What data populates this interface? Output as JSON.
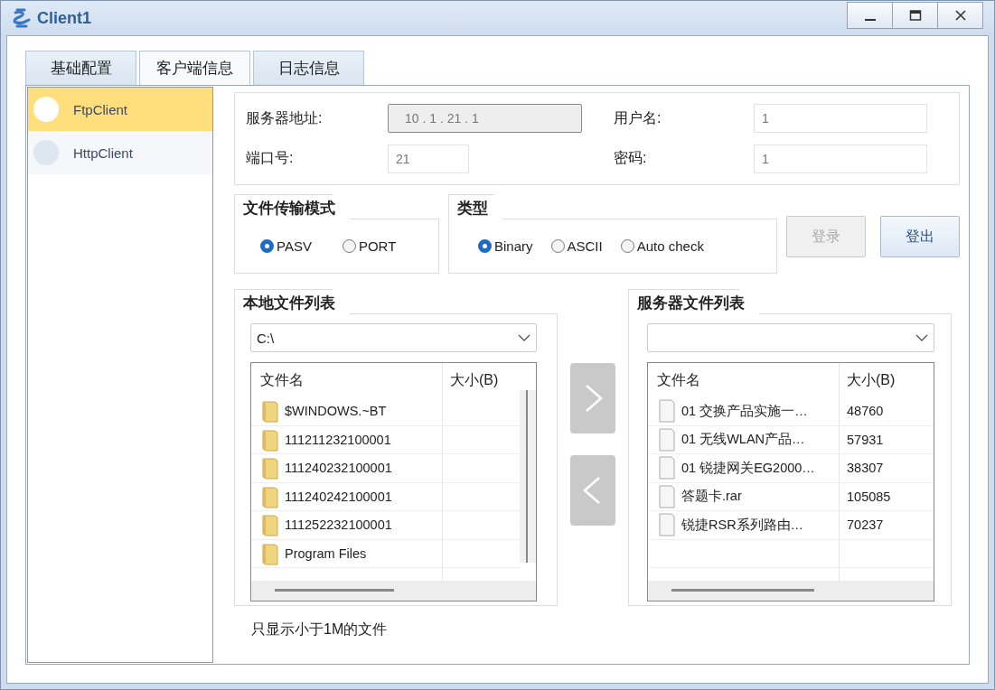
{
  "window": {
    "title": "Client1"
  },
  "tabs": [
    {
      "label": "基础配置",
      "selected": false
    },
    {
      "label": "客户端信息",
      "selected": true
    },
    {
      "label": "日志信息",
      "selected": false
    }
  ],
  "sidebar": {
    "items": [
      {
        "label": "FtpClient",
        "selected": true
      },
      {
        "label": "HttpClient",
        "selected": false
      }
    ]
  },
  "server": {
    "address_label": "服务器地址:",
    "address": "10 . 1 . 21 . 1",
    "port_label": "端口号:",
    "port": "21",
    "username_label": "用户名:",
    "username": "1",
    "password_label": "密码:",
    "password": "1"
  },
  "transfer_mode": {
    "title": "文件传输模式",
    "options": [
      {
        "label": "PASV",
        "selected": true
      },
      {
        "label": "PORT",
        "selected": false
      }
    ]
  },
  "type": {
    "title": "类型",
    "options": [
      {
        "label": "Binary",
        "selected": true
      },
      {
        "label": "ASCII",
        "selected": false
      },
      {
        "label": "Auto check",
        "selected": false
      }
    ]
  },
  "buttons": [
    {
      "label": "登录",
      "disabled": true
    },
    {
      "label": "登出",
      "disabled": false
    }
  ],
  "local_files": {
    "title": "本地文件列表",
    "path": "C:\\",
    "columns": [
      "文件名",
      "大小(B)"
    ],
    "rows": [
      {
        "kind": "folder",
        "name": "$WINDOWS.~BT"
      },
      {
        "kind": "folder",
        "name": "111211232100001"
      },
      {
        "kind": "folder",
        "name": "111240232100001"
      },
      {
        "kind": "folder",
        "name": "111240242100001"
      },
      {
        "kind": "folder",
        "name": "111252232100001"
      },
      {
        "kind": "folder",
        "name": "Program Files"
      }
    ]
  },
  "server_files": {
    "title": "服务器文件列表",
    "columns": [
      "文件名",
      "大小(B)"
    ],
    "rows": [
      {
        "kind": "file",
        "name": "01 交换产品实施一…",
        "size": "48760"
      },
      {
        "kind": "file",
        "name": "01 无线WLAN产品…",
        "size": "57931"
      },
      {
        "kind": "file",
        "name": "01 锐捷网关EG2000…",
        "size": "38307"
      },
      {
        "kind": "file",
        "name": "答题卡.rar",
        "size": "105085"
      },
      {
        "kind": "file",
        "name": "锐捷RSR系列路由…",
        "size": "70237"
      }
    ]
  },
  "note": "只显示小于1M的文件"
}
